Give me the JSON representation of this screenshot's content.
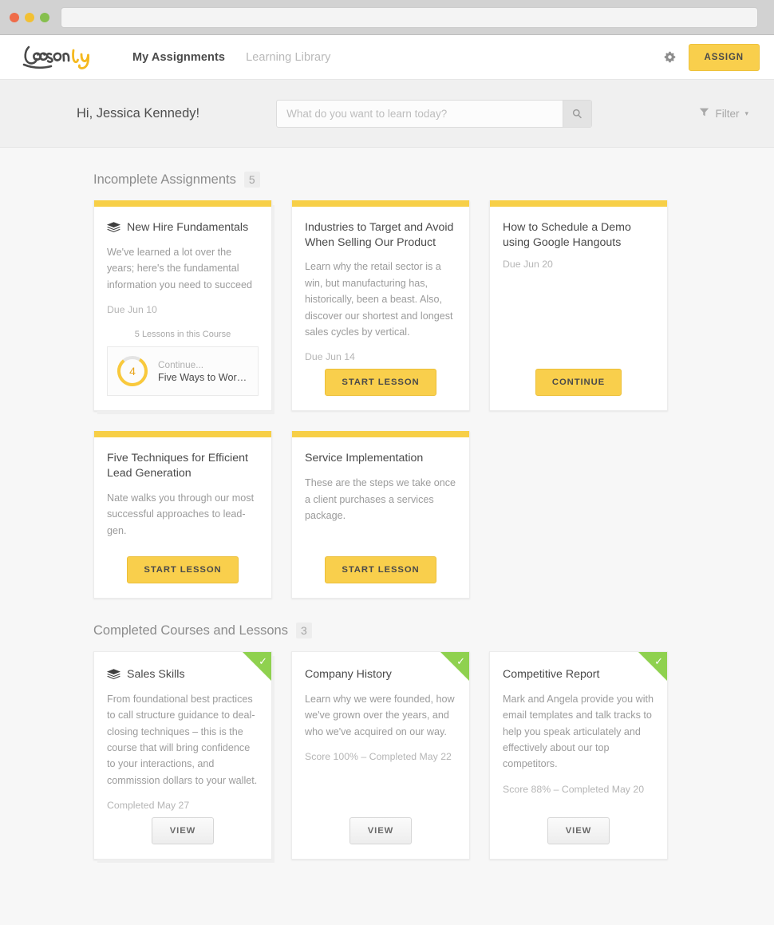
{
  "browser": {
    "url_value": "",
    "traffic_lights": [
      "close-dot",
      "minimize-dot",
      "zoom-dot"
    ]
  },
  "nav": {
    "logo_text": "Lessonly",
    "logo_part_dark": "Lesson",
    "logo_part_accent": "ly",
    "links": [
      {
        "label": "My Assignments",
        "active": true
      },
      {
        "label": "Learning Library",
        "active": false
      }
    ],
    "gear_icon": "gear-icon",
    "assign_label": "ASSIGN"
  },
  "header": {
    "greeting": "Hi, Jessica Kennedy!",
    "search_placeholder": "What do you want to learn today?",
    "search_value": "",
    "search_icon": "search-icon",
    "filter_label": "Filter",
    "filter_icon": "funnel-icon",
    "filter_caret": "▾"
  },
  "sections": {
    "incomplete": {
      "title": "Incomplete Assignments",
      "count": "5"
    },
    "completed": {
      "title": "Completed Courses and Lessons",
      "count": "3"
    }
  },
  "incomplete_cards": [
    {
      "type": "course",
      "icon": "stack-icon",
      "title": "New Hire Fundamentals",
      "desc": "We've learned a lot over the years; here's the fundamental information you need to succeed",
      "meta": "Due Jun 10",
      "lessons_count_label": "5 Lessons in this Course",
      "continue_label": "Continue...",
      "continue_lesson": "Five Ways to Work Smart...",
      "progress_number": "4",
      "progress_percent": 80
    },
    {
      "type": "lesson",
      "title": "Industries to Target and Avoid When Selling Our Product",
      "desc": "Learn why the retail sector is a win, but manufacturing has, historically, been a beast. Also, discover our shortest and longest sales cycles by vertical.",
      "meta": "Due Jun 14",
      "button": "START LESSON"
    },
    {
      "type": "lesson",
      "title": "How to Schedule a Demo using Google Hangouts",
      "desc": "",
      "meta": "Due Jun 20",
      "button": "CONTINUE"
    },
    {
      "type": "lesson",
      "title": "Five Techniques for Efficient Lead Generation",
      "desc": "Nate walks you through our most successful approaches to lead-gen.",
      "meta": "",
      "button": "START LESSON"
    },
    {
      "type": "lesson",
      "title": "Service Implementation",
      "desc": "These are the steps we take once a client purchases a services package.",
      "meta": "",
      "button": "START LESSON"
    }
  ],
  "completed_cards": [
    {
      "type": "course",
      "icon": "stack-icon",
      "title": "Sales Skills",
      "desc": "From foundational best practices to call structure guidance to deal-closing techniques – this is the course that will bring confidence to your interactions, and commission dollars to your wallet.",
      "meta": "Completed May 27",
      "button": "VIEW",
      "badge": "check-icon"
    },
    {
      "type": "lesson",
      "title": "Company History",
      "desc": "Learn why we were founded, how we've grown over the years, and who we've acquired on our way.",
      "meta": "Score 100% – Completed May 22",
      "button": "VIEW",
      "badge": "check-icon"
    },
    {
      "type": "lesson",
      "title": "Competitive Report",
      "desc": "Mark and Angela provide you with email templates and talk tracks to help you speak articulately and effectively about our top competitors.",
      "meta": "Score 88% – Completed May 20",
      "button": "VIEW",
      "badge": "check-icon"
    }
  ],
  "colors": {
    "accent_yellow": "#f9cf4c",
    "complete_green": "#8fd14f",
    "page_bg": "#f7f7f7",
    "text_dark": "#4a4a4a",
    "text_muted": "#9b9b9b"
  }
}
